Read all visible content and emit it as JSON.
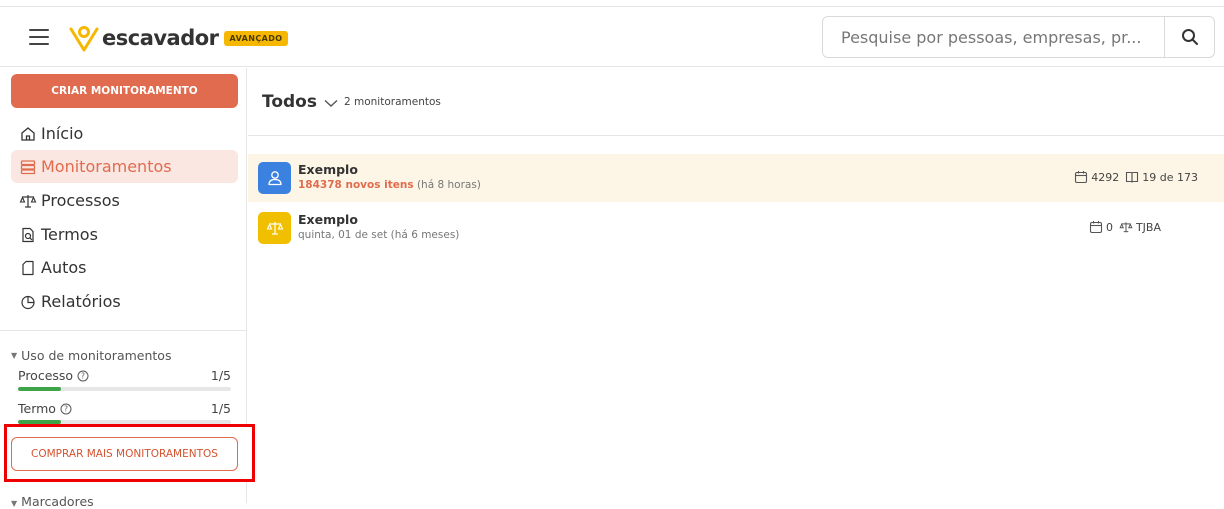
{
  "header": {
    "logo_text": "escavador",
    "logo_badge": "AVANÇADO",
    "search_placeholder": "Pesquise por pessoas, empresas, pr..."
  },
  "sidebar": {
    "create_label": "CRIAR MONITORAMENTO",
    "nav": [
      {
        "label": "Início",
        "icon": "home-icon"
      },
      {
        "label": "Monitoramentos",
        "icon": "stack-icon",
        "active": true
      },
      {
        "label": "Processos",
        "icon": "scales-icon"
      },
      {
        "label": "Termos",
        "icon": "document-search-icon"
      },
      {
        "label": "Autos",
        "icon": "file-icon"
      },
      {
        "label": "Relatórios",
        "icon": "pie-chart-icon"
      }
    ],
    "usage": {
      "title": "Uso de monitoramentos",
      "items": [
        {
          "label": "Processo",
          "count": "1/5",
          "fraction": 0.2
        },
        {
          "label": "Termo",
          "count": "1/5",
          "fraction": 0.2
        }
      ]
    },
    "buy_label": "COMPRAR MAIS MONITORAMENTOS",
    "markers_label": "Marcadores"
  },
  "main": {
    "filter_label": "Todos",
    "filter_count": "2 monitoramentos",
    "rows": [
      {
        "title": "Exemplo",
        "new_items": "184378 novos itens",
        "time": "(há 8 horas)",
        "meta1": "4292",
        "meta2": "19 de 173",
        "icon": "person-icon",
        "color": "#3b82e0"
      },
      {
        "title": "Exemplo",
        "sub": "quinta, 01 de set (há 6 meses)",
        "meta1": "0",
        "meta2": "TJBA",
        "icon": "scales-icon",
        "color": "#f0c000"
      }
    ]
  },
  "colors": {
    "accent": "#e06b4e",
    "badge": "#f5b700",
    "progress": "#3da548",
    "highlight_border": "#ee0000"
  }
}
